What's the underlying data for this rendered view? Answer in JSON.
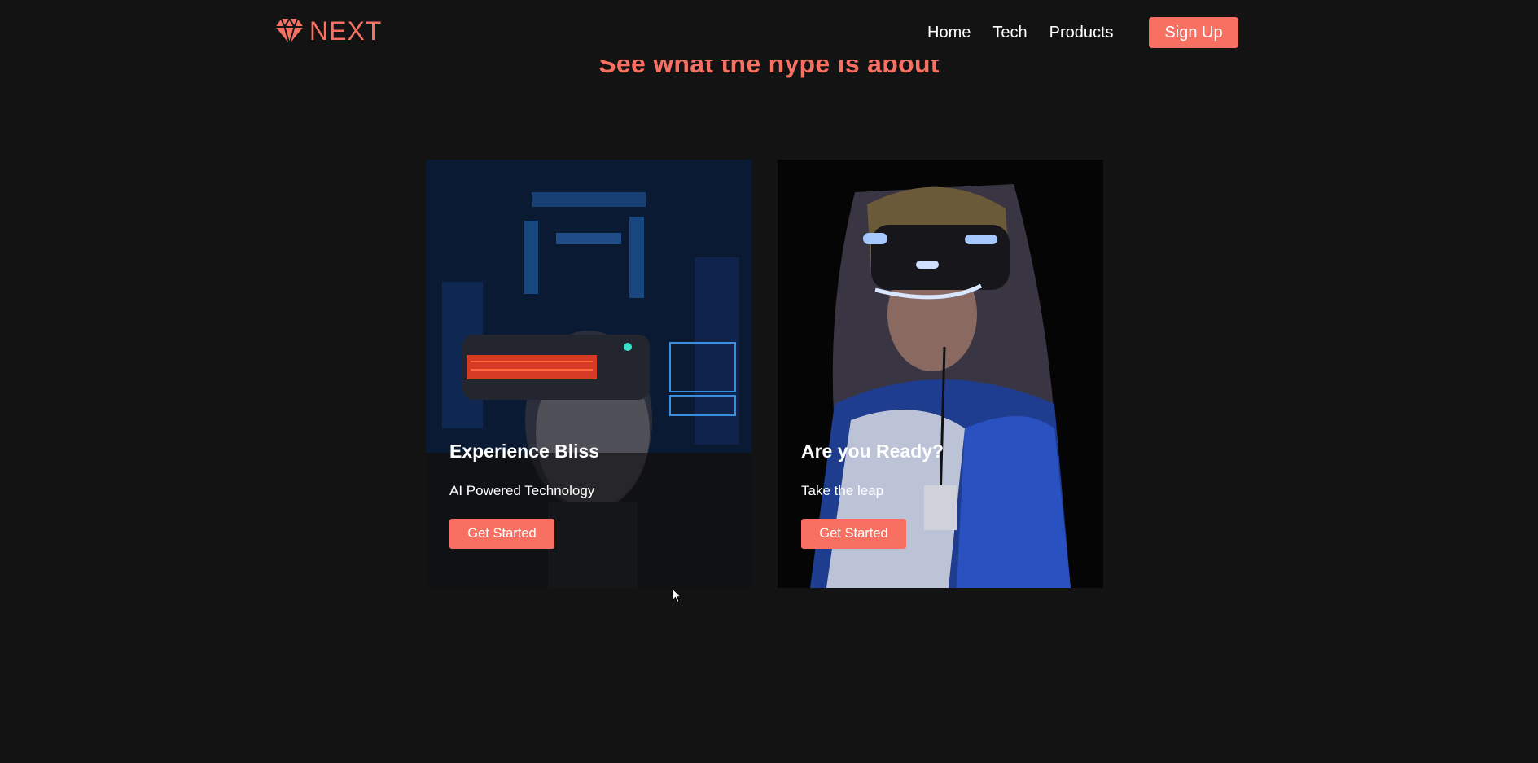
{
  "brand": {
    "name": "NEXT",
    "color": "#f77062",
    "icon": "diamond-icon"
  },
  "nav": {
    "links": [
      {
        "label": "Home"
      },
      {
        "label": "Tech"
      },
      {
        "label": "Products"
      }
    ],
    "signup_label": "Sign Up"
  },
  "hero": {
    "title": "See what the hype is about"
  },
  "cards": [
    {
      "title": "Experience Bliss",
      "description": "AI Powered Technology",
      "button_label": "Get Started",
      "image": "man-with-vr-headset-photo"
    },
    {
      "title": "Are you Ready?",
      "description": "Take the leap",
      "button_label": "Get Started",
      "image": "woman-with-vr-headset-photo"
    }
  ],
  "colors": {
    "background": "#131313",
    "accent": "#f77062",
    "text": "#ffffff"
  }
}
